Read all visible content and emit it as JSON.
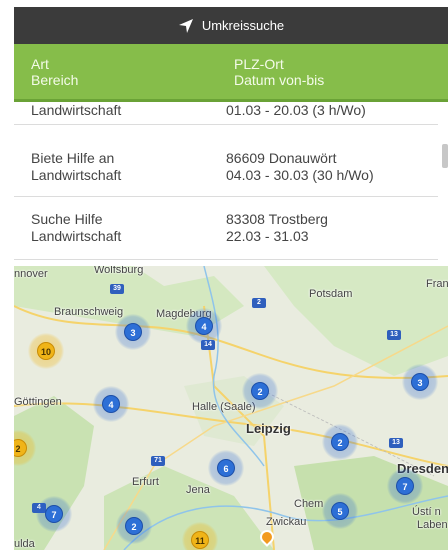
{
  "topbar": {
    "label": "Umkreissuche",
    "icon": "location-arrow-icon"
  },
  "header": {
    "col1_line1": "Art",
    "col1_line2": "Bereich",
    "col2_line1": "PLZ-Ort",
    "col2_line2": "Datum von-bis"
  },
  "listings": [
    {
      "type": "",
      "area": "Landwirtschaft",
      "location": "",
      "dates": "01.03 - 20.03  (3 h/Wo)"
    },
    {
      "type": "Biete Hilfe an",
      "area": "Landwirtschaft",
      "location": "86609 Donauwört",
      "dates": "04.03 - 30.03  (30 h/Wo)"
    },
    {
      "type": "Suche Hilfe",
      "area": "Landwirtschaft",
      "location": "83308 Trostberg",
      "dates": "22.03 - 31.03"
    }
  ],
  "map": {
    "places": {
      "hannover": "nnover",
      "wolfsburg": "Wolfsburg",
      "braunschweig": "Braunschweig",
      "magdeburg": "Magdeburg",
      "potsdam": "Potsdam",
      "frankfurt_oder": "Fran",
      "goettingen": "Göttingen",
      "halle": "Halle (Saale)",
      "leipzig": "Leipzig",
      "dresden": "Dresden",
      "erfurt": "Erfurt",
      "jena": "Jena",
      "chemnitz": "Chem",
      "zwickau": "Zwickau",
      "usti": "Ústí n",
      "labem": "Laben",
      "fulda": "ulda"
    },
    "clusters": [
      {
        "count": "3",
        "color": "blue"
      },
      {
        "count": "4",
        "color": "blue"
      },
      {
        "count": "10",
        "color": "yellow"
      },
      {
        "count": "2",
        "color": "blue"
      },
      {
        "count": "3",
        "color": "blue"
      },
      {
        "count": "4",
        "color": "blue"
      },
      {
        "count": "2",
        "color": "yellow"
      },
      {
        "count": "2",
        "color": "blue"
      },
      {
        "count": "6",
        "color": "blue"
      },
      {
        "count": "7",
        "color": "blue"
      },
      {
        "count": "5",
        "color": "blue"
      },
      {
        "count": "7",
        "color": "blue"
      },
      {
        "count": "2",
        "color": "blue"
      },
      {
        "count": "11",
        "color": "yellow"
      }
    ],
    "road_shields": [
      "39",
      "2",
      "14",
      "13",
      "71",
      "13",
      "4"
    ]
  },
  "colors": {
    "accent_green": "#86bd4a",
    "topbar": "#3b3b3b",
    "cluster_blue": "#2d6fd6",
    "cluster_yellow": "#f0b418"
  }
}
